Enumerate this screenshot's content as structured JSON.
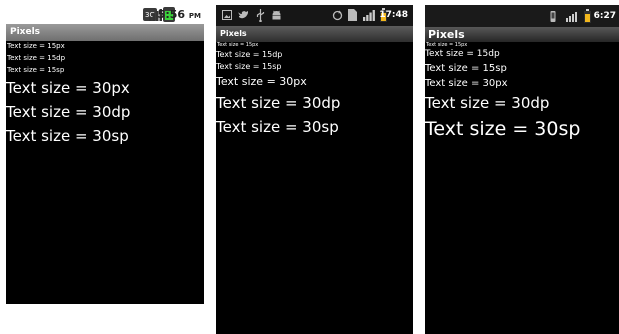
{
  "phones": [
    {
      "time": "5:56",
      "ampm": "PM",
      "title": "Pixels",
      "lines": [
        "Text size = 15px",
        "Text size = 15dp",
        "Text size = 15sp",
        "Text size = 30px",
        "Text size = 30dp",
        "Text size = 30sp"
      ]
    },
    {
      "time": "17:48",
      "title": "Pixels",
      "lines": [
        "Text size = 15px",
        "Text size = 15dp",
        "Text size = 15sp",
        "Text size = 30px",
        "Text size = 30dp",
        "Text size = 30sp"
      ]
    },
    {
      "time": "6:27",
      "title": "Pixels",
      "lines": [
        "Text size = 15px",
        "Text size = 15dp",
        "Text size = 15sp",
        "Text size = 30px",
        "Text size = 30dp",
        "Text size = 30sp"
      ]
    }
  ],
  "icons": {
    "phone1": [
      "network-3g-icon",
      "signal-bars-icon",
      "battery-icon"
    ],
    "phone2": [
      "image-icon",
      "twitter-icon",
      "usb-icon",
      "android-icon",
      "sync-icon",
      "sd-card-icon",
      "signal-bars-icon",
      "battery-icon"
    ],
    "phone3": [
      "vibrate-icon",
      "signal-bars-icon",
      "battery-icon"
    ]
  }
}
